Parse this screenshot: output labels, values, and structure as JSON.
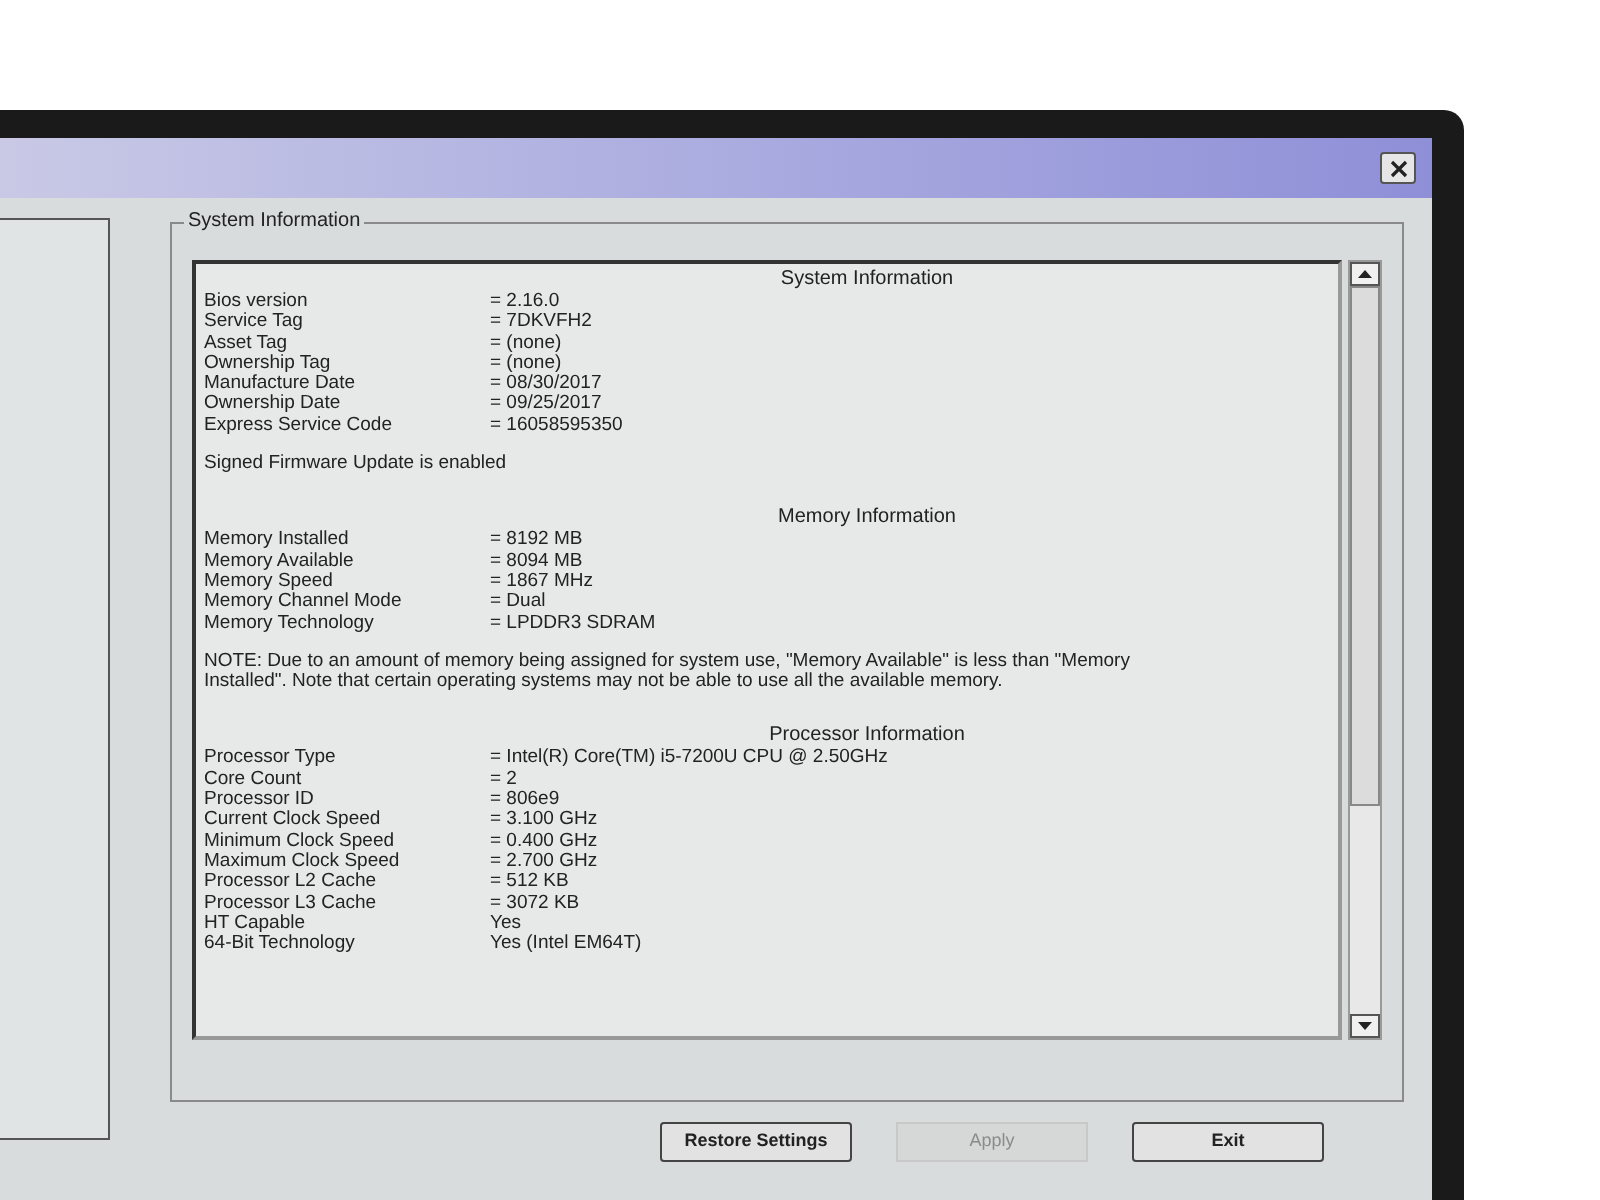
{
  "group_title": "System Information",
  "sections": [
    {
      "title": "System Information",
      "rows": [
        {
          "label": "Bios version",
          "value": "= 2.16.0"
        },
        {
          "label": "Service Tag",
          "value": "= 7DKVFH2"
        },
        {
          "label": "Asset Tag",
          "value": "= (none)"
        },
        {
          "label": "Ownership Tag",
          "value": "= (none)"
        },
        {
          "label": "Manufacture Date",
          "value": "= 08/30/2017"
        },
        {
          "label": "Ownership Date",
          "value": "= 09/25/2017"
        },
        {
          "label": "Express Service Code",
          "value": "= 16058595350"
        }
      ],
      "note": "Signed Firmware Update is enabled"
    },
    {
      "title": "Memory Information",
      "rows": [
        {
          "label": "Memory Installed",
          "value": "= 8192 MB"
        },
        {
          "label": "Memory Available",
          "value": "= 8094 MB"
        },
        {
          "label": "Memory Speed",
          "value": "= 1867 MHz"
        },
        {
          "label": "Memory Channel Mode",
          "value": "= Dual"
        },
        {
          "label": "Memory Technology",
          "value": "= LPDDR3 SDRAM"
        }
      ],
      "note": "NOTE: Due to an amount of memory being assigned for system use, \"Memory Available\" is less than \"Memory Installed\". Note that certain operating systems may not be able to use all the available memory."
    },
    {
      "title": "Processor Information",
      "rows": [
        {
          "label": "Processor Type",
          "value": "= Intel(R) Core(TM) i5-7200U CPU @ 2.50GHz"
        },
        {
          "label": "Core Count",
          "value": "= 2"
        },
        {
          "label": "Processor ID",
          "value": "= 806e9"
        },
        {
          "label": "Current Clock Speed",
          "value": "= 3.100 GHz"
        },
        {
          "label": "Minimum Clock Speed",
          "value": "= 0.400 GHz"
        },
        {
          "label": "Maximum Clock Speed",
          "value": "= 2.700 GHz"
        },
        {
          "label": "Processor L2 Cache",
          "value": "= 512 KB"
        },
        {
          "label": "Processor L3 Cache",
          "value": "= 3072 KB"
        },
        {
          "label": "HT Capable",
          "value": "Yes"
        },
        {
          "label": "64-Bit Technology",
          "value": "Yes (Intel EM64T)"
        }
      ]
    }
  ],
  "buttons": [
    {
      "label": "Restore Settings",
      "disabled": false
    },
    {
      "label": "Apply",
      "disabled": true
    },
    {
      "label": "Exit",
      "disabled": false
    }
  ]
}
